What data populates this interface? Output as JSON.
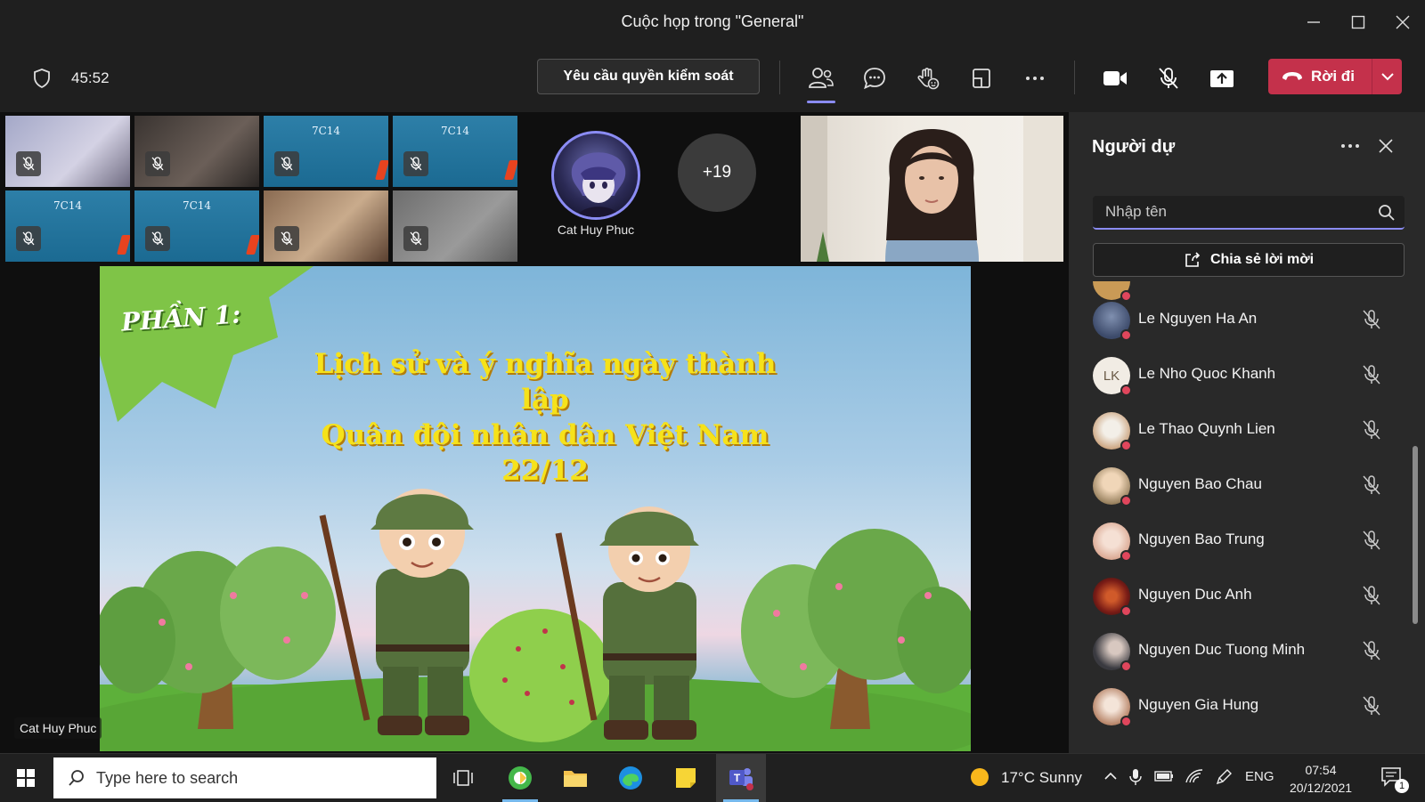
{
  "window": {
    "title": "Cuộc họp trong \"General\""
  },
  "toolbar": {
    "timer": "45:52",
    "request_control_label": "Yêu cầu quyền kiểm soát",
    "leave_label": "Rời đi"
  },
  "stage": {
    "avatar_name": "Cat Huy Phuc",
    "more_count": "+19",
    "presenter_label": "Cat Huy Phuc",
    "thumb_label": "7C14",
    "slide": {
      "section": "PHẦN 1:",
      "title_line1": "Lịch sử và ý nghĩa ngày thành lập",
      "title_line2": "Quân đội nhân dân Việt Nam 22/12"
    }
  },
  "panel": {
    "title": "Người dự",
    "search_placeholder": "Nhập tên",
    "invite_label": "Chia sẻ lời mời",
    "participants": [
      {
        "name": "Le Nguyen Ha An",
        "avatar_color": "#3c4a6a"
      },
      {
        "name": "Le Nho Quoc Khanh",
        "initials": "LK",
        "avatar_color": "#f1ece4"
      },
      {
        "name": "Le Thao Quynh Lien",
        "avatar_color": "#c9a07a"
      },
      {
        "name": "Nguyen Bao Chau",
        "avatar_color": "#d8c7a4"
      },
      {
        "name": "Nguyen Bao Trung",
        "avatar_color": "#d9a58f"
      },
      {
        "name": "Nguyen Duc Anh",
        "avatar_color": "#7a1c16"
      },
      {
        "name": "Nguyen Duc Tuong Minh",
        "avatar_color": "#3a3a40"
      },
      {
        "name": "Nguyen Gia Hung",
        "avatar_color": "#b8866a"
      }
    ]
  },
  "taskbar": {
    "search_placeholder": "Type here to search",
    "weather": "17°C  Sunny",
    "language": "ENG",
    "time": "07:54",
    "date": "20/12/2021",
    "notification_count": "1"
  },
  "colors": {
    "accent": "#8b8cf4",
    "leave": "#c4314b",
    "panel_bg": "#292929"
  }
}
